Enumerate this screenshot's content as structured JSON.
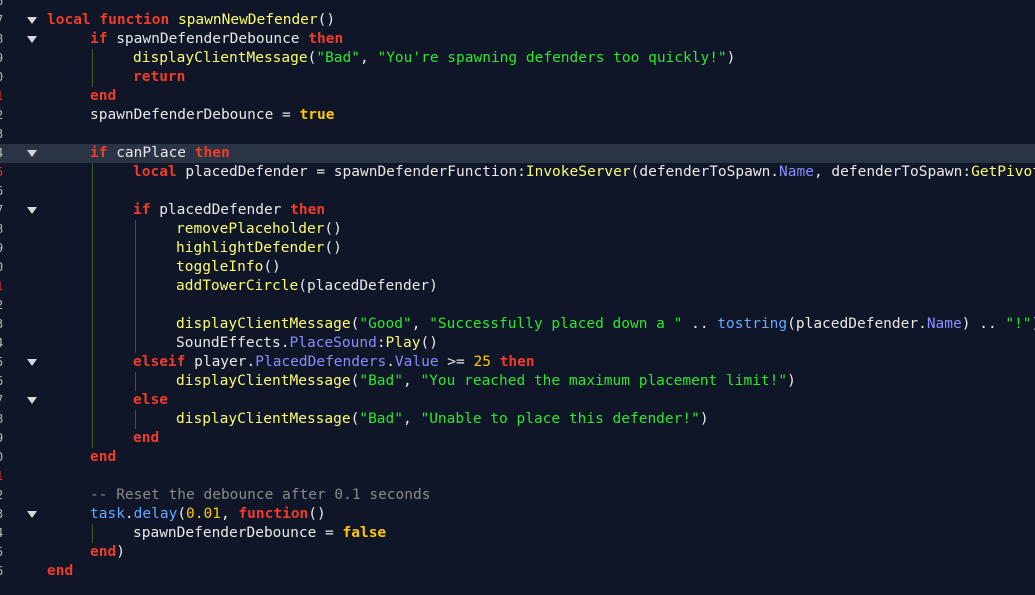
{
  "editor": {
    "language": "lua",
    "current_line_index": 8,
    "gutter_numbers": [
      "6",
      "3",
      "9",
      "0",
      "1",
      "2",
      "3",
      "4",
      "5",
      "6",
      "7",
      "8",
      "9",
      "0",
      "1",
      "2",
      "3",
      "4",
      "5",
      "6",
      "7",
      "8",
      "9",
      "0",
      "1",
      "2",
      "3",
      "4",
      "5",
      "6",
      "5",
      "6"
    ],
    "colors": {
      "background": "#0e1628",
      "current_line": "#2b3445",
      "keyword": "#f03c28",
      "function": "#fdfd6e",
      "string": "#2ee62e",
      "boolean": "#ffc800",
      "property": "#8c8cff",
      "builtin": "#67a8ff",
      "comment": "#8a8a8a",
      "text": "#e8e8e8"
    }
  },
  "lines": [
    {
      "gutter": "6",
      "mod": false,
      "fold": false,
      "indent": 0,
      "tokens": []
    },
    {
      "gutter": "7",
      "mod": false,
      "fold": true,
      "indent": 0,
      "tokens": [
        [
          "kw",
          "local"
        ],
        [
          "op",
          " "
        ],
        [
          "kw",
          "function"
        ],
        [
          "op",
          " "
        ],
        [
          "fn",
          "spawnNewDefender"
        ],
        [
          "op",
          "()"
        ]
      ]
    },
    {
      "gutter": "8",
      "mod": false,
      "fold": true,
      "indent": 1,
      "tokens": [
        [
          "kw",
          "if"
        ],
        [
          "op",
          " spawnDefenderDebounce "
        ],
        [
          "kw",
          "then"
        ]
      ]
    },
    {
      "gutter": "9",
      "mod": false,
      "fold": false,
      "indent": 2,
      "tokens": [
        [
          "fn",
          "displayClientMessage"
        ],
        [
          "op",
          "("
        ],
        [
          "str",
          "\"Bad\""
        ],
        [
          "op",
          ", "
        ],
        [
          "str",
          "\"You're spawning defenders too quickly!\""
        ],
        [
          "op",
          ")"
        ]
      ]
    },
    {
      "gutter": "0",
      "mod": false,
      "fold": false,
      "indent": 2,
      "tokens": [
        [
          "kw",
          "return"
        ]
      ]
    },
    {
      "gutter": "1",
      "mod": true,
      "fold": false,
      "indent": 1,
      "tokens": [
        [
          "kw",
          "end"
        ]
      ]
    },
    {
      "gutter": "2",
      "mod": false,
      "fold": false,
      "indent": 1,
      "tokens": [
        [
          "op",
          "spawnDefenderDebounce = "
        ],
        [
          "bool",
          "true"
        ]
      ]
    },
    {
      "gutter": "3",
      "mod": false,
      "fold": false,
      "indent": 1,
      "tokens": []
    },
    {
      "gutter": "4",
      "mod": false,
      "fold": true,
      "indent": 1,
      "tokens": [
        [
          "kw",
          "if"
        ],
        [
          "op",
          " canPlace "
        ],
        [
          "kw",
          "then"
        ]
      ]
    },
    {
      "gutter": "5",
      "mod": true,
      "fold": false,
      "indent": 2,
      "tokens": [
        [
          "kw",
          "local"
        ],
        [
          "op",
          " placedDefender = spawnDefenderFunction:"
        ],
        [
          "fn",
          "InvokeServer"
        ],
        [
          "op",
          "(defenderToSpawn."
        ],
        [
          "prop",
          "Name"
        ],
        [
          "op",
          ", defenderToSpawn:"
        ],
        [
          "fn",
          "GetPivot"
        ],
        [
          "op",
          "("
        ]
      ]
    },
    {
      "gutter": "6",
      "mod": false,
      "fold": false,
      "indent": 2,
      "tokens": []
    },
    {
      "gutter": "7",
      "mod": false,
      "fold": true,
      "indent": 2,
      "tokens": [
        [
          "kw",
          "if"
        ],
        [
          "op",
          " placedDefender "
        ],
        [
          "kw",
          "then"
        ]
      ]
    },
    {
      "gutter": "8",
      "mod": false,
      "fold": false,
      "indent": 3,
      "tokens": [
        [
          "fn",
          "removePlaceholder"
        ],
        [
          "op",
          "()"
        ]
      ]
    },
    {
      "gutter": "9",
      "mod": false,
      "fold": false,
      "indent": 3,
      "tokens": [
        [
          "fn",
          "highlightDefender"
        ],
        [
          "op",
          "()"
        ]
      ]
    },
    {
      "gutter": "0",
      "mod": false,
      "fold": false,
      "indent": 3,
      "tokens": [
        [
          "fn",
          "toggleInfo"
        ],
        [
          "op",
          "()"
        ]
      ]
    },
    {
      "gutter": "1",
      "mod": true,
      "fold": false,
      "indent": 3,
      "tokens": [
        [
          "fn",
          "addTowerCircle"
        ],
        [
          "op",
          "(placedDefender)"
        ]
      ]
    },
    {
      "gutter": "2",
      "mod": false,
      "fold": false,
      "indent": 3,
      "tokens": []
    },
    {
      "gutter": "3",
      "mod": false,
      "fold": false,
      "indent": 3,
      "tokens": [
        [
          "fn",
          "displayClientMessage"
        ],
        [
          "op",
          "("
        ],
        [
          "str",
          "\"Good\""
        ],
        [
          "op",
          ", "
        ],
        [
          "str",
          "\"Successfully placed down a \""
        ],
        [
          "op",
          " .. "
        ],
        [
          "builtin",
          "tostring"
        ],
        [
          "op",
          "(placedDefender."
        ],
        [
          "prop",
          "Name"
        ],
        [
          "op",
          ") .. "
        ],
        [
          "str",
          "\"!\""
        ],
        [
          "op",
          ")"
        ]
      ]
    },
    {
      "gutter": "4",
      "mod": false,
      "fold": false,
      "indent": 3,
      "tokens": [
        [
          "op",
          "SoundEffects."
        ],
        [
          "prop",
          "PlaceSound"
        ],
        [
          "op",
          ":"
        ],
        [
          "fn",
          "Play"
        ],
        [
          "op",
          "()"
        ]
      ]
    },
    {
      "gutter": "5",
      "mod": false,
      "fold": true,
      "indent": 2,
      "tokens": [
        [
          "kw",
          "elseif"
        ],
        [
          "op",
          " player."
        ],
        [
          "prop",
          "PlacedDefenders"
        ],
        [
          "op",
          "."
        ],
        [
          "prop",
          "Value"
        ],
        [
          "op",
          " >= "
        ],
        [
          "num",
          "25"
        ],
        [
          "op",
          " "
        ],
        [
          "kw",
          "then"
        ]
      ]
    },
    {
      "gutter": "6",
      "mod": false,
      "fold": false,
      "indent": 3,
      "tokens": [
        [
          "fn",
          "displayClientMessage"
        ],
        [
          "op",
          "("
        ],
        [
          "str",
          "\"Bad\""
        ],
        [
          "op",
          ", "
        ],
        [
          "str",
          "\"You reached the maximum placement limit!\""
        ],
        [
          "op",
          ")"
        ]
      ]
    },
    {
      "gutter": "7",
      "mod": false,
      "fold": true,
      "indent": 2,
      "tokens": [
        [
          "kw",
          "else"
        ]
      ]
    },
    {
      "gutter": "8",
      "mod": false,
      "fold": false,
      "indent": 3,
      "tokens": [
        [
          "fn",
          "displayClientMessage"
        ],
        [
          "op",
          "("
        ],
        [
          "str",
          "\"Bad\""
        ],
        [
          "op",
          ", "
        ],
        [
          "str",
          "\"Unable to place this defender!\""
        ],
        [
          "op",
          ")"
        ]
      ]
    },
    {
      "gutter": "9",
      "mod": false,
      "fold": false,
      "indent": 2,
      "tokens": [
        [
          "kw",
          "end"
        ]
      ]
    },
    {
      "gutter": "0",
      "mod": false,
      "fold": false,
      "indent": 1,
      "tokens": [
        [
          "kw",
          "end"
        ]
      ]
    },
    {
      "gutter": "1",
      "mod": true,
      "fold": false,
      "indent": 1,
      "tokens": []
    },
    {
      "gutter": "2",
      "mod": false,
      "fold": false,
      "indent": 1,
      "tokens": [
        [
          "cmt",
          "-- Reset the debounce after 0.1 seconds"
        ]
      ]
    },
    {
      "gutter": "3",
      "mod": false,
      "fold": true,
      "indent": 1,
      "tokens": [
        [
          "builtin",
          "task"
        ],
        [
          "op",
          "."
        ],
        [
          "builtin",
          "delay"
        ],
        [
          "op",
          "("
        ],
        [
          "num",
          "0.01"
        ],
        [
          "op",
          ", "
        ],
        [
          "kw",
          "function"
        ],
        [
          "op",
          "()"
        ]
      ]
    },
    {
      "gutter": "4",
      "mod": false,
      "fold": false,
      "indent": 2,
      "tokens": [
        [
          "op",
          "spawnDefenderDebounce = "
        ],
        [
          "bool",
          "false"
        ]
      ]
    },
    {
      "gutter": "5",
      "mod": false,
      "fold": false,
      "indent": 1,
      "tokens": [
        [
          "kw",
          "end"
        ],
        [
          "op",
          ")"
        ]
      ]
    },
    {
      "gutter": "6",
      "mod": false,
      "fold": false,
      "indent": 0,
      "tokens": [
        [
          "kw",
          "end"
        ]
      ]
    }
  ]
}
